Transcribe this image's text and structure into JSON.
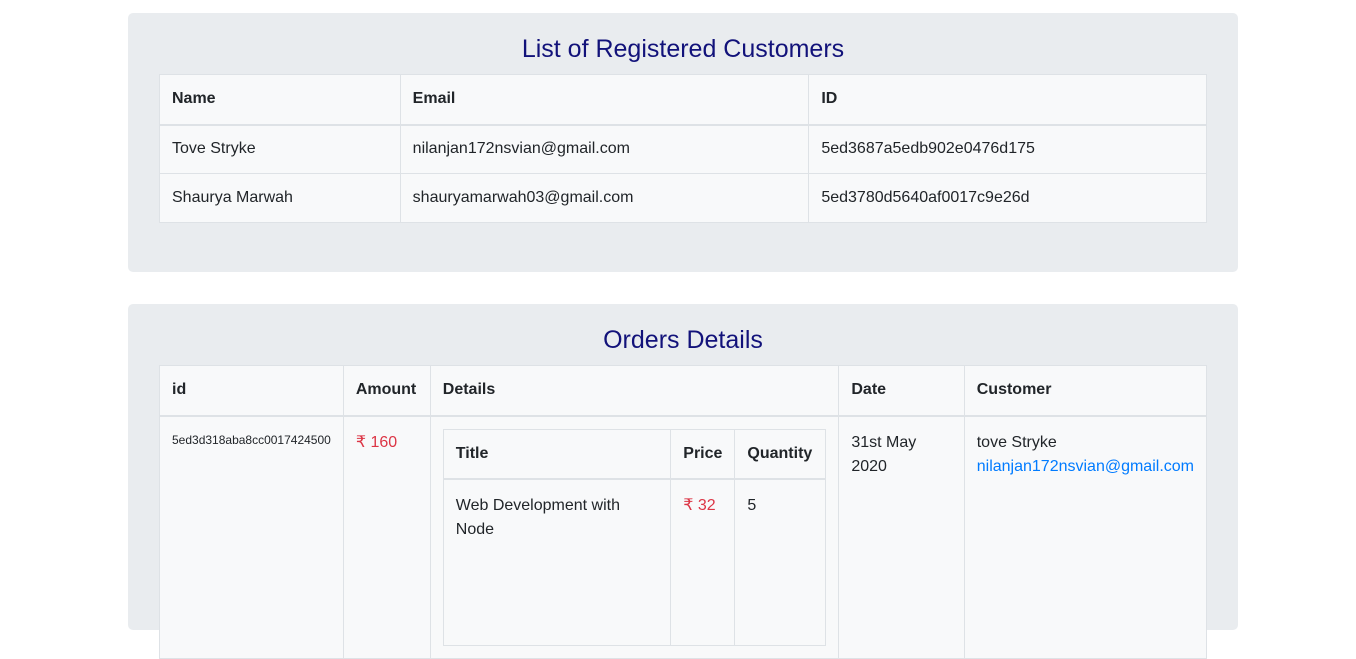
{
  "customers": {
    "title": "List of Registered Customers",
    "headers": [
      "Name",
      "Email",
      "ID"
    ],
    "rows": [
      {
        "name": "Tove Stryke",
        "email": "nilanjan172nsvian@gmail.com",
        "id": "5ed3687a5edb902e0476d175"
      },
      {
        "name": "Shaurya Marwah",
        "email": "shauryamarwah03@gmail.com",
        "id": "5ed3780d5640af0017c9e26d"
      }
    ]
  },
  "orders": {
    "title": "Orders Details",
    "headers": [
      "id",
      "Amount",
      "Details",
      "Date",
      "Customer"
    ],
    "rows": [
      {
        "id": "5ed3d318aba8cc0017424500",
        "amount": "₹ 160",
        "details": {
          "headers": [
            "Title",
            "Price",
            "Quantity"
          ],
          "items": [
            {
              "title": "Web Development with Node",
              "price": "₹ 32",
              "quantity": "5"
            }
          ]
        },
        "date": "31st May 2020",
        "customer_name": "tove Stryke",
        "customer_email": "nilanjan172nsvian@gmail.com"
      }
    ]
  },
  "colors": {
    "panel_bg": "#e9ecef",
    "heading": "#12127a",
    "price": "#dc3545",
    "link": "#007bff"
  }
}
